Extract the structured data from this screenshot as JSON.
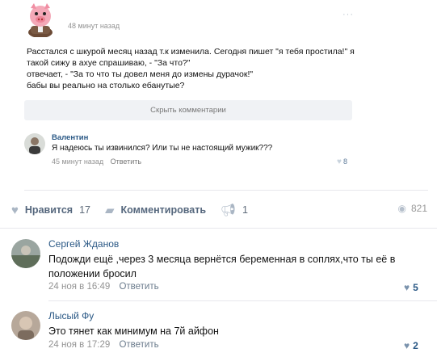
{
  "post": {
    "time": "48 минут назад",
    "more": "···",
    "text_lines": [
      "Расстался с шкурой месяц назад т.к изменила. Сегодня пишет \"я тебя простила!\" я",
      "такой сижу в ахуе спрашиваю, - \"За что?\"",
      "отвечает, - \"За то что ты довел меня до измены дурачок!\"",
      "бабы вы реально на столько ебанутые?"
    ],
    "hide_comments": "Скрыть комментарии"
  },
  "inner_comment": {
    "name": "Валентин",
    "text": "Я надеюсь ты извинился? Или ты не настоящий мужик???",
    "time": "45 минут назад",
    "reply": "Ответить",
    "likes": "8"
  },
  "actions": {
    "like_label": "Нравится",
    "like_count": "17",
    "comment_label": "Комментировать",
    "share_count": "1",
    "views": "821"
  },
  "comments": [
    {
      "name": "Сергей Жданов",
      "text_lines": [
        "Подожди ещё ,через 3 месяца вернётся беременная в соплях,что ты её в",
        "положении бросил"
      ],
      "time": "24 ноя в 16:49",
      "reply": "Ответить",
      "likes": "5"
    },
    {
      "name": "Лысый Фу",
      "text_lines": [
        "Это тянет как минимум на 7й айфон"
      ],
      "time": "24 ноя в 17:29",
      "reply": "Ответить",
      "likes": "2"
    }
  ],
  "colors": {
    "link": "#2a5885",
    "meta": "#939393",
    "divider": "#e7e8ec",
    "button_bg": "#f0f2f5"
  }
}
